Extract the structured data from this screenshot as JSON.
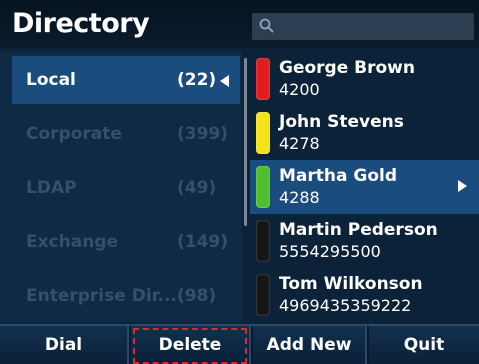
{
  "header": {
    "title": "Directory",
    "search_icon": "search-icon"
  },
  "categories": [
    {
      "label": "Local",
      "count": "(22)",
      "selected": true
    },
    {
      "label": "Corporate",
      "count": "(399)",
      "selected": false
    },
    {
      "label": "LDAP",
      "count": "(49)",
      "selected": false
    },
    {
      "label": "Exchange",
      "count": "(149)",
      "selected": false
    },
    {
      "label": "Enterprise Dir...",
      "count": "(98)",
      "selected": false
    }
  ],
  "contacts": [
    {
      "name": "George Brown",
      "number": "4200",
      "status_color": "#e01c1c",
      "selected": false
    },
    {
      "name": "John Stevens",
      "number": "4278",
      "status_color": "#f2e419",
      "selected": false
    },
    {
      "name": "Martha Gold",
      "number": "4288",
      "status_color": "#4fbf2e",
      "selected": true
    },
    {
      "name": "Martin Pederson",
      "number": "5554295500",
      "status_color": "#151515",
      "selected": false
    },
    {
      "name": "Tom Wilkonson",
      "number": "4969435359222",
      "status_color": "#151515",
      "selected": false
    }
  ],
  "softkeys": {
    "dial": "Dial",
    "delete": "Delete",
    "add_new": "Add New",
    "quit": "Quit"
  },
  "colors": {
    "selection": "#1b4c7e",
    "focus_outline": "#e02626"
  }
}
